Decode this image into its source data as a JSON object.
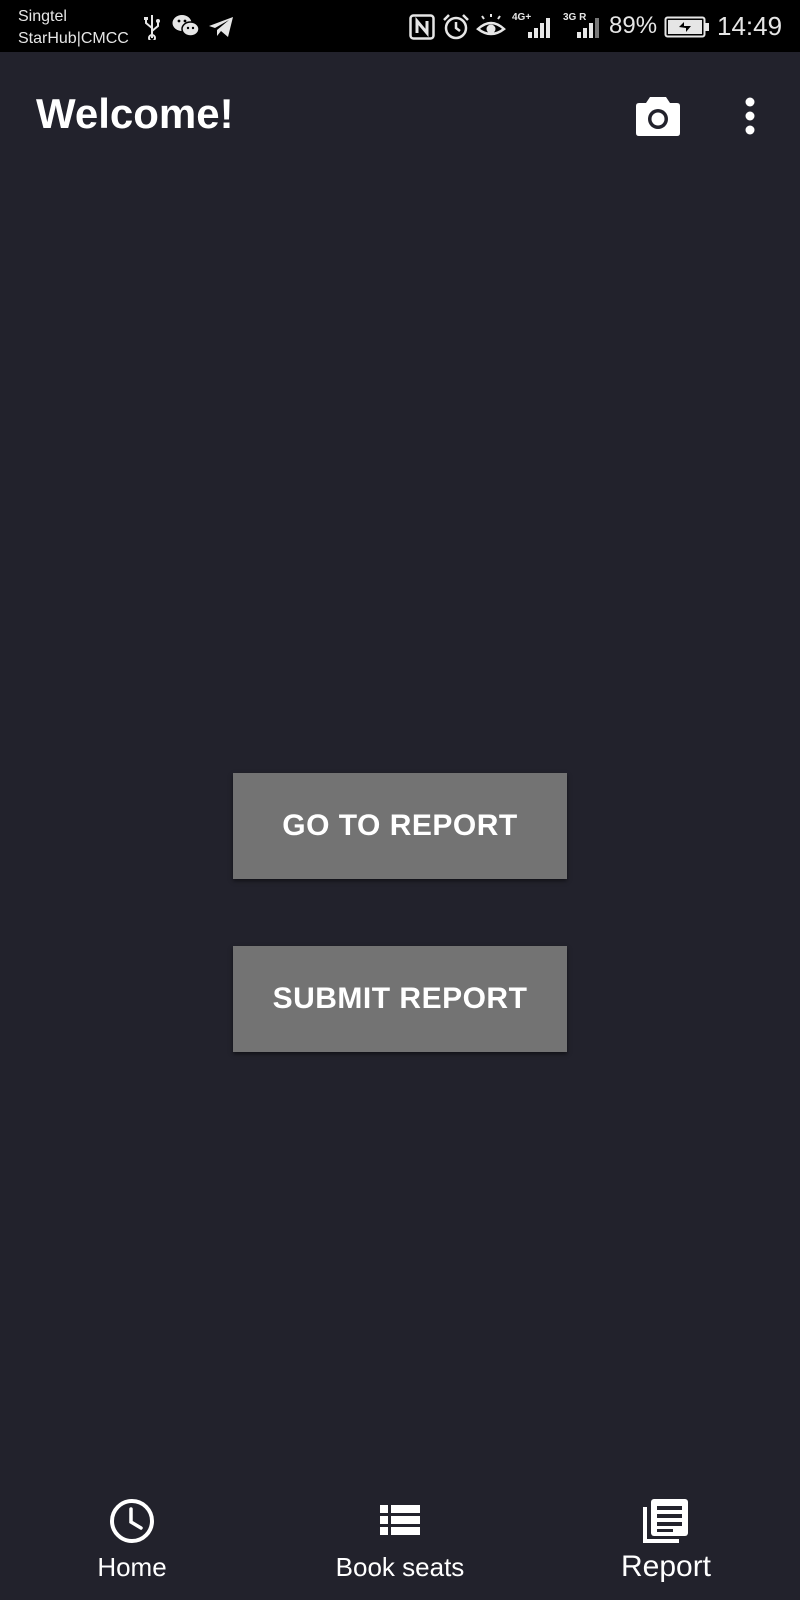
{
  "status_bar": {
    "carrier_line1": "Singtel",
    "carrier_line2": "StarHub|CMCC",
    "left_icons": [
      "usb-icon",
      "wechat-icon",
      "telegram-icon"
    ],
    "right_icons": [
      "nfc-icon",
      "alarm-icon",
      "eye-comfort-icon",
      "signal-4g-icon",
      "signal-3g-icon"
    ],
    "network_1": "4G+",
    "network_2": "3G R",
    "battery": "89%",
    "battery_charging": true,
    "time": "14:49"
  },
  "app_bar": {
    "title": "Welcome!",
    "actions": [
      "camera-icon",
      "more-vert-icon"
    ]
  },
  "main": {
    "go_to_report_label": "GO TO REPORT",
    "submit_report_label": "SUBMIT REPORT"
  },
  "bottom_nav": {
    "items": [
      {
        "label": "Home",
        "icon": "clock-icon"
      },
      {
        "label": "Book seats",
        "icon": "list-icon"
      },
      {
        "label": "Report",
        "icon": "newspaper-icon",
        "active": true
      }
    ]
  },
  "colors": {
    "background": "#22222c",
    "status_bar": "#000000",
    "button": "#737373",
    "text": "#ffffff"
  }
}
